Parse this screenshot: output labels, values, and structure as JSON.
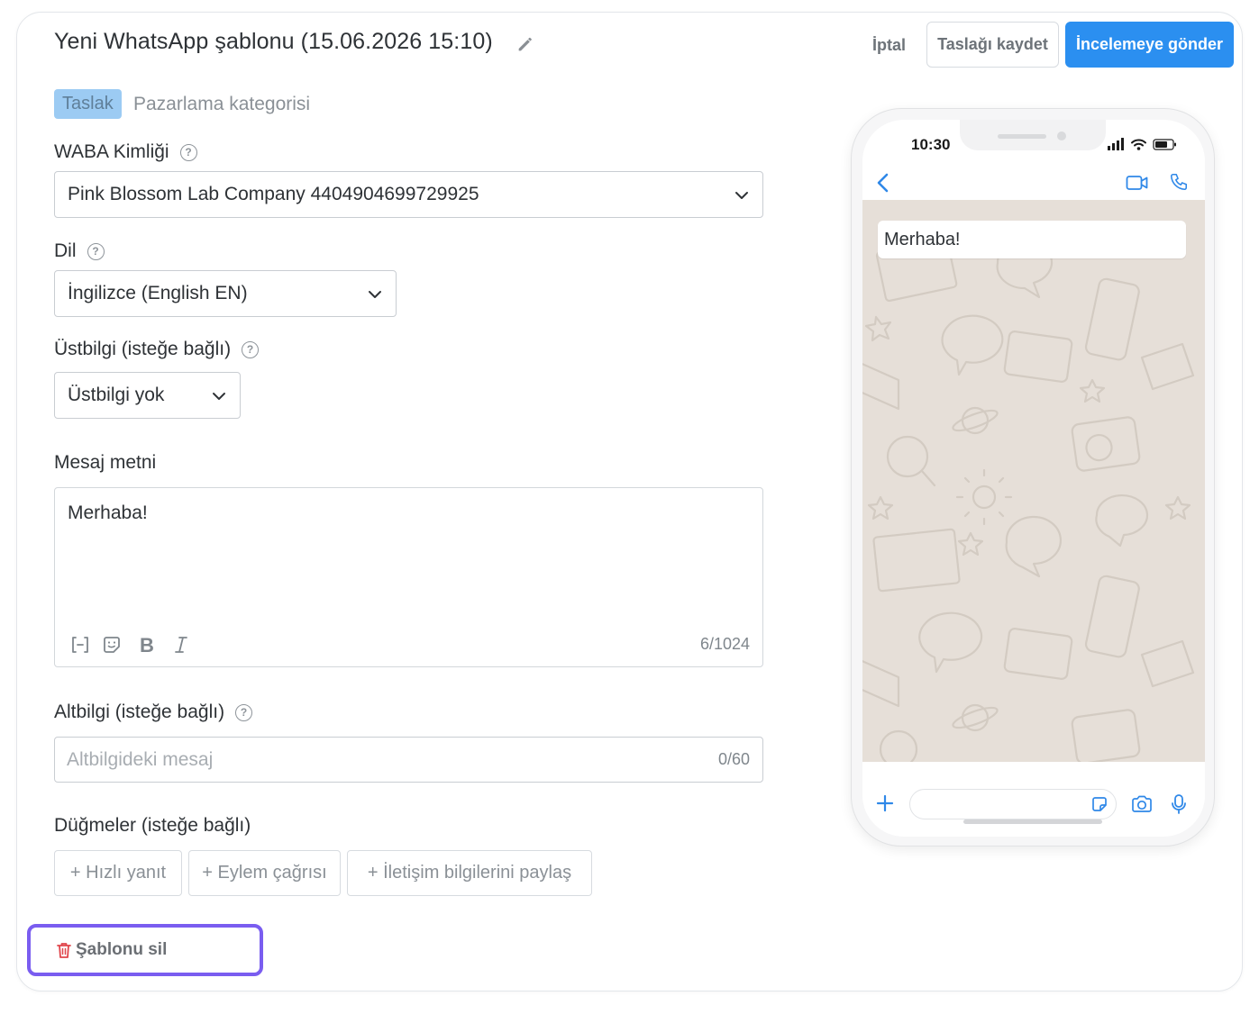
{
  "header": {
    "title": "Yeni WhatsApp şablonu (15.06.2026 15:10)",
    "cancel_label": "İptal",
    "save_draft_label": "Taslağı kaydet",
    "submit_label": "İncelemeye gönder"
  },
  "status": {
    "badge": "Taslak",
    "category": "Pazarlama kategorisi"
  },
  "form": {
    "waba": {
      "label": "WABA Kimliği",
      "value": "Pink Blossom Lab Company 4404904699729925"
    },
    "language": {
      "label": "Dil",
      "value": "İngilizce (English EN)"
    },
    "header": {
      "label": "Üstbilgi (isteğe bağlı)",
      "value": "Üstbilgi yok"
    },
    "message": {
      "label": "Mesaj metni",
      "value": "Merhaba!",
      "counter": "6/1024"
    },
    "footer": {
      "label": "Altbilgi (isteğe bağlı)",
      "placeholder": "Altbilgideki mesaj",
      "counter": "0/60"
    },
    "buttons": {
      "label": "Düğmeler (isteğe bağlı)",
      "quick_reply": "+ Hızlı yanıt",
      "call_to_action": "+ Eylem çağrısı",
      "share_contact": "+ İletişim bilgilerini paylaş"
    }
  },
  "delete_label": "Şablonu sil",
  "preview": {
    "time": "10:30",
    "message": "Merhaba!"
  },
  "colors": {
    "primary": "#2b8ff0",
    "badge_bg": "#9ccbf3",
    "delete_highlight": "#7a5df0",
    "delete_icon": "#e0454b",
    "chat_bg": "#e6dfd8",
    "whatsapp_blue": "#2f88e8"
  },
  "icons": {
    "edit": "pencil-icon",
    "help": "question-circle-icon",
    "dropdown": "chevron-down-icon",
    "variable": "variable-brackets-icon",
    "emoji": "sticker-emoji-icon",
    "bold": "bold-icon",
    "italic": "italic-icon",
    "delete": "trash-icon"
  }
}
